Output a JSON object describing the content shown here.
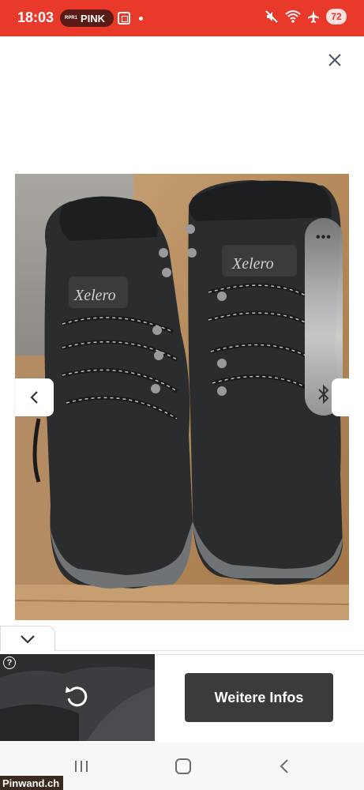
{
  "status_bar": {
    "time": "18:03",
    "rpr_small": "RPR1",
    "rpr_label": "PINK",
    "battery": "72",
    "color": "#e8392b"
  },
  "viewer": {
    "close_icon": "close-icon",
    "prev_icon": "chevron-left-icon",
    "next_icon": "chevron-right-icon",
    "photo_subject": "photo",
    "brand_text": "Xelero"
  },
  "side_panel": {
    "menu_icon": "more-dots-icon",
    "dots": "•••",
    "bottom_icon": "bluetooth-icon"
  },
  "ad": {
    "collapse_icon": "chevron-down-icon",
    "help_label": "?",
    "replay_icon": "replay-icon",
    "cta_label": "Weitere Infos"
  },
  "nav_bar": {
    "recent_icon": "recent-apps-icon",
    "home_icon": "home-icon",
    "back_icon": "back-icon"
  },
  "watermark": {
    "text": "Pinwand.ch"
  }
}
